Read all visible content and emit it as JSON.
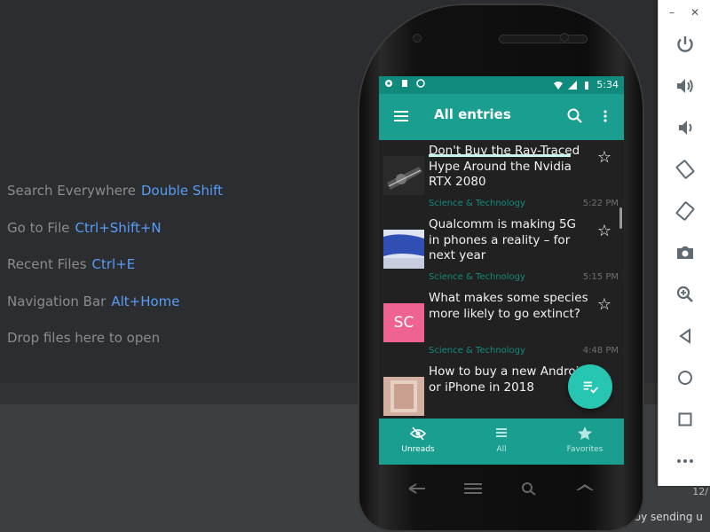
{
  "ide": {
    "hints": [
      {
        "label": "Search Everywhere",
        "key": "Double Shift"
      },
      {
        "label": "Go to File",
        "key": "Ctrl+Shift+N"
      },
      {
        "label": "Recent Files",
        "key": "Ctrl+E"
      },
      {
        "label": "Navigation Bar",
        "key": "Alt+Home"
      },
      {
        "label": "Drop files here to open",
        "key": ""
      }
    ],
    "status_right": "12/",
    "bottom_text": "io by sending u"
  },
  "colors": {
    "app_primary": "#1a9e8f",
    "status_bar": "#0f8a7d",
    "fab": "#26c6b3",
    "category": "#138a7e",
    "ide_link": "#589df6"
  },
  "emulator_toolbar": {
    "window_controls": [
      "–",
      "✕"
    ],
    "buttons": [
      "power-icon",
      "volume-up-icon",
      "volume-down-icon",
      "rotate-left-icon",
      "rotate-right-icon",
      "camera-icon",
      "zoom-icon",
      "back-icon",
      "home-icon",
      "overview-icon",
      "more-icon"
    ]
  },
  "phone": {
    "status_bar": {
      "time": "5:34"
    },
    "app_bar": {
      "title": "All entries"
    },
    "entries": [
      {
        "title": "Don't Buy the Ray-Traced Hype Around the Nvidia RTX 2080",
        "category": "Science & Technology",
        "time": "5:22 PM",
        "thumb": "gpu"
      },
      {
        "title": "Qualcomm is making 5G in phones a reality – for next year",
        "category": "Science & Technology",
        "time": "5:15 PM",
        "thumb": "qualcomm"
      },
      {
        "title": "What makes some species more likely to go extinct?",
        "category": "Science & Technology",
        "time": "4:48 PM",
        "thumb": "letters",
        "thumb_text": "SC"
      },
      {
        "title": "How to buy a new Android or iPhone in 2018",
        "category": "",
        "time": "",
        "thumb": "phone"
      }
    ],
    "bottom_nav": [
      {
        "label": "Unreads",
        "icon": "eye-off-icon",
        "active": true
      },
      {
        "label": "All",
        "icon": "list-icon",
        "active": false
      },
      {
        "label": "Favorites",
        "icon": "star-icon",
        "active": false
      }
    ]
  }
}
